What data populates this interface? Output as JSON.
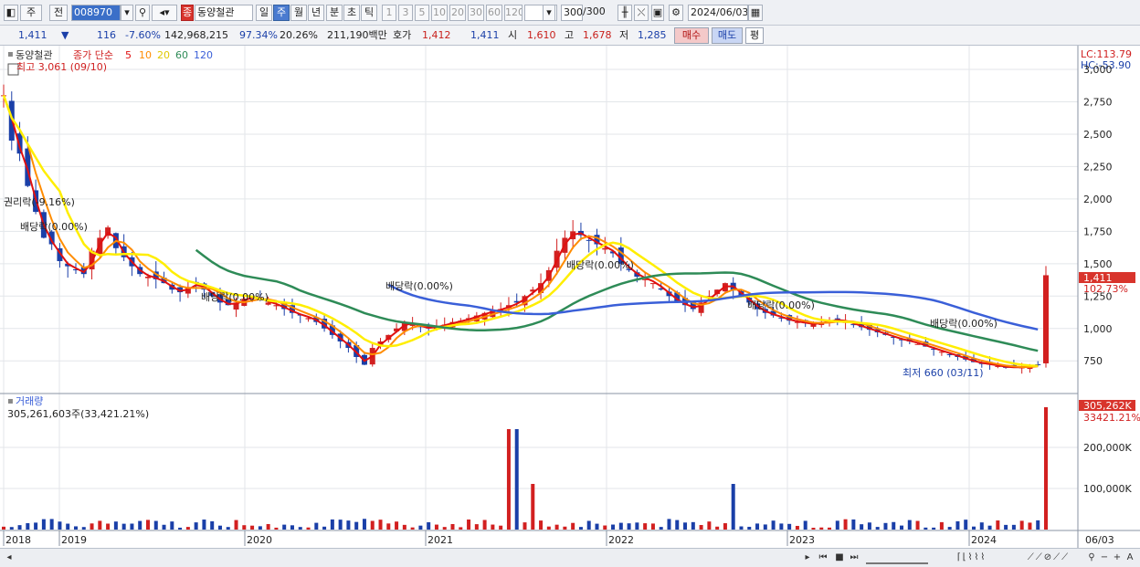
{
  "toolbar": {
    "market": "주",
    "prev": "전",
    "code": "008970",
    "logo": "종",
    "stock_name": "동양철관",
    "periods": [
      "일",
      "주",
      "월",
      "년",
      "분",
      "초",
      "틱"
    ],
    "selected_period": "주",
    "intervals": [
      "1",
      "3",
      "5",
      "10",
      "20",
      "30",
      "60",
      "120"
    ],
    "count": "300",
    "count_total": "/300",
    "date": "2024/06/03"
  },
  "quote": {
    "price": "1,411",
    "change": "116",
    "change_pct": "-7.60%",
    "volume": "142,968,215",
    "ratio1": "97.34%",
    "ratio2": "20.26%",
    "amount": "211,190백만",
    "bid_label": "호가",
    "bid": "1,412",
    "ask": "1,411",
    "open_label": "시",
    "open": "1,610",
    "high_label": "고",
    "high": "1,678",
    "low_label": "저",
    "low": "1,285",
    "buy_label": "매수",
    "sell_label": "매도",
    "avg_label": "평"
  },
  "colors": {
    "ma5": "#e01010",
    "ma10": "#ff8c00",
    "ma20": "#ffee00",
    "ma60": "#2e8b57",
    "ma120": "#3a5fd8",
    "up": "#d22020",
    "down": "#1a3fa8"
  },
  "chart_data": [
    {
      "type": "candlestick",
      "title": "동양철관",
      "legend": [
        "종가 단순",
        "5",
        "10",
        "20",
        "60",
        "120"
      ],
      "ylim": [
        600,
        3100
      ],
      "y_ticks": [
        "3,000",
        "2,750",
        "2,500",
        "2,250",
        "2,000",
        "1,750",
        "1,500",
        "1,250",
        "1,000",
        "750"
      ],
      "x_ticks": [
        "2018",
        "2019",
        "2020",
        "2021",
        "2022",
        "2023",
        "2024",
        "06/03"
      ],
      "grid": true,
      "annotations": {
        "max_label": "최고 3,061 (09/10)",
        "min_label": "최저 660 (03/11)",
        "rights_label": "권리락(-9.16%)",
        "dividend_label": "배당락(0.00%)",
        "lc_label": "LC:113.79",
        "hc_label": "HC:-53.90",
        "last_price": "1,411",
        "last_pct": "102.73%"
      },
      "series": {
        "close": [
          2800,
          2450,
          2350,
          2100,
          1900,
          1700,
          1650,
          1520,
          1480,
          1450,
          1420,
          1600,
          1700,
          1780,
          1620,
          1550,
          1480,
          1420,
          1400,
          1380,
          1350,
          1300,
          1280,
          1320,
          1350,
          1300,
          1250,
          1200,
          1180,
          1200,
          1230,
          1250,
          1220,
          1200,
          1180,
          1150,
          1120,
          1100,
          1080,
          1050,
          1000,
          950,
          900,
          850,
          780,
          720,
          850,
          900,
          950,
          1000,
          1050,
          1030,
          1010,
          1000,
          1020,
          1030,
          1050,
          1060,
          1080,
          1100,
          1120,
          1140,
          1150,
          1180,
          1200,
          1250,
          1300,
          1350,
          1450,
          1600,
          1700,
          1750,
          1720,
          1680,
          1650,
          1620,
          1580,
          1500,
          1450,
          1400,
          1380,
          1350,
          1300,
          1250,
          1200,
          1180,
          1150,
          1200,
          1250,
          1300,
          1350,
          1300,
          1250,
          1200,
          1150,
          1120,
          1100,
          1080,
          1060,
          1050,
          1040,
          1030,
          1050,
          1060,
          1070,
          1050,
          1030,
          1010,
          990,
          970,
          950,
          930,
          910,
          900,
          880,
          860,
          840,
          820,
          800,
          780,
          760,
          740,
          730,
          720,
          710,
          700,
          700,
          700,
          710,
          720,
          1411
        ]
      },
      "ma60_last": 850,
      "ma120_last": 980
    },
    {
      "type": "bar",
      "title": "거래량",
      "volume_label": "305,261,603주(33,421.21%)",
      "y_ticks": [
        "200,000K",
        "100,000K"
      ],
      "last_volume": "305,262K",
      "last_pct": "33421.21%"
    }
  ]
}
